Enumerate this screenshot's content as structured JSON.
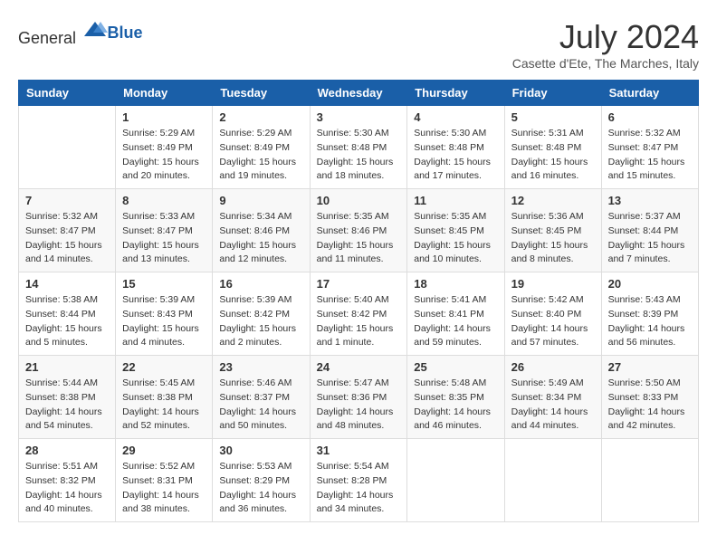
{
  "logo": {
    "general": "General",
    "blue": "Blue"
  },
  "header": {
    "month": "July 2024",
    "location": "Casette d'Ete, The Marches, Italy"
  },
  "weekdays": [
    "Sunday",
    "Monday",
    "Tuesday",
    "Wednesday",
    "Thursday",
    "Friday",
    "Saturday"
  ],
  "weeks": [
    [
      {
        "day": "",
        "info": ""
      },
      {
        "day": "1",
        "info": "Sunrise: 5:29 AM\nSunset: 8:49 PM\nDaylight: 15 hours\nand 20 minutes."
      },
      {
        "day": "2",
        "info": "Sunrise: 5:29 AM\nSunset: 8:49 PM\nDaylight: 15 hours\nand 19 minutes."
      },
      {
        "day": "3",
        "info": "Sunrise: 5:30 AM\nSunset: 8:48 PM\nDaylight: 15 hours\nand 18 minutes."
      },
      {
        "day": "4",
        "info": "Sunrise: 5:30 AM\nSunset: 8:48 PM\nDaylight: 15 hours\nand 17 minutes."
      },
      {
        "day": "5",
        "info": "Sunrise: 5:31 AM\nSunset: 8:48 PM\nDaylight: 15 hours\nand 16 minutes."
      },
      {
        "day": "6",
        "info": "Sunrise: 5:32 AM\nSunset: 8:47 PM\nDaylight: 15 hours\nand 15 minutes."
      }
    ],
    [
      {
        "day": "7",
        "info": "Sunrise: 5:32 AM\nSunset: 8:47 PM\nDaylight: 15 hours\nand 14 minutes."
      },
      {
        "day": "8",
        "info": "Sunrise: 5:33 AM\nSunset: 8:47 PM\nDaylight: 15 hours\nand 13 minutes."
      },
      {
        "day": "9",
        "info": "Sunrise: 5:34 AM\nSunset: 8:46 PM\nDaylight: 15 hours\nand 12 minutes."
      },
      {
        "day": "10",
        "info": "Sunrise: 5:35 AM\nSunset: 8:46 PM\nDaylight: 15 hours\nand 11 minutes."
      },
      {
        "day": "11",
        "info": "Sunrise: 5:35 AM\nSunset: 8:45 PM\nDaylight: 15 hours\nand 10 minutes."
      },
      {
        "day": "12",
        "info": "Sunrise: 5:36 AM\nSunset: 8:45 PM\nDaylight: 15 hours\nand 8 minutes."
      },
      {
        "day": "13",
        "info": "Sunrise: 5:37 AM\nSunset: 8:44 PM\nDaylight: 15 hours\nand 7 minutes."
      }
    ],
    [
      {
        "day": "14",
        "info": "Sunrise: 5:38 AM\nSunset: 8:44 PM\nDaylight: 15 hours\nand 5 minutes."
      },
      {
        "day": "15",
        "info": "Sunrise: 5:39 AM\nSunset: 8:43 PM\nDaylight: 15 hours\nand 4 minutes."
      },
      {
        "day": "16",
        "info": "Sunrise: 5:39 AM\nSunset: 8:42 PM\nDaylight: 15 hours\nand 2 minutes."
      },
      {
        "day": "17",
        "info": "Sunrise: 5:40 AM\nSunset: 8:42 PM\nDaylight: 15 hours\nand 1 minute."
      },
      {
        "day": "18",
        "info": "Sunrise: 5:41 AM\nSunset: 8:41 PM\nDaylight: 14 hours\nand 59 minutes."
      },
      {
        "day": "19",
        "info": "Sunrise: 5:42 AM\nSunset: 8:40 PM\nDaylight: 14 hours\nand 57 minutes."
      },
      {
        "day": "20",
        "info": "Sunrise: 5:43 AM\nSunset: 8:39 PM\nDaylight: 14 hours\nand 56 minutes."
      }
    ],
    [
      {
        "day": "21",
        "info": "Sunrise: 5:44 AM\nSunset: 8:38 PM\nDaylight: 14 hours\nand 54 minutes."
      },
      {
        "day": "22",
        "info": "Sunrise: 5:45 AM\nSunset: 8:38 PM\nDaylight: 14 hours\nand 52 minutes."
      },
      {
        "day": "23",
        "info": "Sunrise: 5:46 AM\nSunset: 8:37 PM\nDaylight: 14 hours\nand 50 minutes."
      },
      {
        "day": "24",
        "info": "Sunrise: 5:47 AM\nSunset: 8:36 PM\nDaylight: 14 hours\nand 48 minutes."
      },
      {
        "day": "25",
        "info": "Sunrise: 5:48 AM\nSunset: 8:35 PM\nDaylight: 14 hours\nand 46 minutes."
      },
      {
        "day": "26",
        "info": "Sunrise: 5:49 AM\nSunset: 8:34 PM\nDaylight: 14 hours\nand 44 minutes."
      },
      {
        "day": "27",
        "info": "Sunrise: 5:50 AM\nSunset: 8:33 PM\nDaylight: 14 hours\nand 42 minutes."
      }
    ],
    [
      {
        "day": "28",
        "info": "Sunrise: 5:51 AM\nSunset: 8:32 PM\nDaylight: 14 hours\nand 40 minutes."
      },
      {
        "day": "29",
        "info": "Sunrise: 5:52 AM\nSunset: 8:31 PM\nDaylight: 14 hours\nand 38 minutes."
      },
      {
        "day": "30",
        "info": "Sunrise: 5:53 AM\nSunset: 8:29 PM\nDaylight: 14 hours\nand 36 minutes."
      },
      {
        "day": "31",
        "info": "Sunrise: 5:54 AM\nSunset: 8:28 PM\nDaylight: 14 hours\nand 34 minutes."
      },
      {
        "day": "",
        "info": ""
      },
      {
        "day": "",
        "info": ""
      },
      {
        "day": "",
        "info": ""
      }
    ]
  ]
}
